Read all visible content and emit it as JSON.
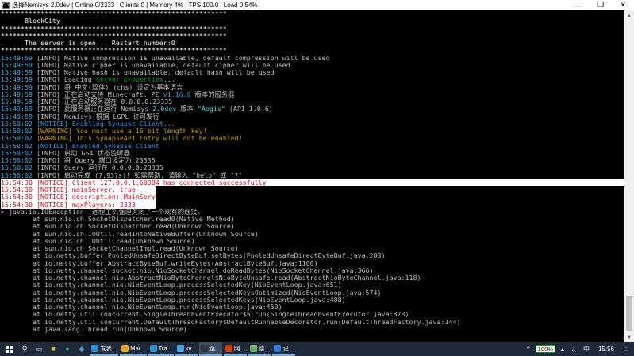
{
  "window": {
    "title": "选择Nemisys 2.0dev | Online 0/2333 | Clients 0 | Memory 4% | TPS 100.0 | Load 0.54%",
    "icon": "console-icon"
  },
  "console": {
    "lines": [
      [
        {
          "t": "*********************************************************",
          "c": "c-w"
        }
      ],
      [
        {
          "t": "      BlockCity",
          "c": "c-w"
        }
      ],
      [
        {
          "t": "*********************************************************",
          "c": "c-w"
        }
      ],
      [
        {
          "t": "*********************************************************",
          "c": "c-w"
        }
      ],
      [
        {
          "t": "      The server is open... Restart number:0",
          "c": "c-w"
        }
      ],
      [
        {
          "t": "*********************************************************",
          "c": "c-w"
        }
      ],
      [
        {
          "t": "15:49:59 ",
          "c": "c-ts"
        },
        {
          "t": "[INFO] Native compression is unavailable, default compression will be used",
          "c": "c-g"
        }
      ],
      [
        {
          "t": "15:49:59 ",
          "c": "c-ts"
        },
        {
          "t": "[INFO] Native cipher is unavailable, default cipher will be used",
          "c": "c-g"
        }
      ],
      [
        {
          "t": "15:49:59 ",
          "c": "c-ts"
        },
        {
          "t": "[INFO] Native hash is unavailable, default hash will be used",
          "c": "c-g"
        }
      ],
      [
        {
          "t": "15:49:59 ",
          "c": "c-ts"
        },
        {
          "t": "[INFO] Loading ",
          "c": "c-g"
        },
        {
          "t": "server properties",
          "c": "c-g2"
        },
        {
          "t": "...",
          "c": "c-g"
        }
      ],
      [
        {
          "t": "15:49:59 ",
          "c": "c-ts"
        },
        {
          "t": "[INFO] 将 中文(简体) (chs) 设定为基本语言",
          "c": "c-g"
        }
      ],
      [
        {
          "t": "15:49:59 ",
          "c": "c-ts"
        },
        {
          "t": "[INFO] 正在启动支持 Minecraft: PE ",
          "c": "c-g"
        },
        {
          "t": "v1.16.0",
          "c": "c-c"
        },
        {
          "t": " 版本的服务器",
          "c": "c-g"
        }
      ],
      [
        {
          "t": "15:49:59 ",
          "c": "c-ts"
        },
        {
          "t": "[INFO] 正在启动服务器在 0.0.0.0:23335",
          "c": "c-g"
        }
      ],
      [
        {
          "t": "15:49:59 ",
          "c": "c-ts"
        },
        {
          "t": "[INFO] 此服务器正在运行 Nemisys ",
          "c": "c-g"
        },
        {
          "t": "2.0dev",
          "c": "c-ct"
        },
        {
          "t": " 版本 ",
          "c": "c-g"
        },
        {
          "t": "\"Aegis\"",
          "c": "c-ct"
        },
        {
          "t": " (API 1.0.6)",
          "c": "c-g"
        }
      ],
      [
        {
          "t": "15:49:59 ",
          "c": "c-ts"
        },
        {
          "t": "[INFO] Nemisys 根据 LGPL 许可发行",
          "c": "c-g"
        }
      ],
      [
        {
          "t": "15:50:02 ",
          "c": "c-ts"
        },
        {
          "t": "[NOTICE] Enabling Synapse Client...",
          "c": "c-c"
        }
      ],
      [
        {
          "t": "15:50:02 ",
          "c": "c-ts"
        },
        {
          "t": "[WARNING] You must use a 16 bit length key!",
          "c": "c-y"
        }
      ],
      [
        {
          "t": "15:50:02 ",
          "c": "c-ts"
        },
        {
          "t": "[WARNING] This SynapseAPI Entry will not be enabled!",
          "c": "c-y"
        }
      ],
      [
        {
          "t": "15:50:02 ",
          "c": "c-ts"
        },
        {
          "t": "[NOTICE] Enabled Synapse Client",
          "c": "c-c"
        }
      ],
      [
        {
          "t": "15:50:02 ",
          "c": "c-ts"
        },
        {
          "t": "[INFO] 启动 GS4 状态监听器",
          "c": "c-g"
        }
      ],
      [
        {
          "t": "15:50:02 ",
          "c": "c-ts"
        },
        {
          "t": "[INFO] 将 Query 端口设定为 23335",
          "c": "c-g"
        }
      ],
      [
        {
          "t": "15:50:02 ",
          "c": "c-ts"
        },
        {
          "t": "[INFO] Query 运行在 0.0.0.0:23335",
          "c": "c-g"
        }
      ],
      [
        {
          "t": "15:50:02 ",
          "c": "c-ts"
        },
        {
          "t": "[INFO] 启动完成 (7.937s)! 如需帮助, 请输入 \"help\" 或 \"?\"",
          "c": "c-g"
        }
      ],
      [
        {
          "t": "15:54:30 [NOTICE] Client 127.0.0.1:60384 has connected successfully",
          "c": "c-r",
          "sel": true
        }
      ],
      [
        {
          "t": "15:54:30 [NOTICE] mainServer: true",
          "c": "c-r",
          "sel": true,
          "selw": 195
        }
      ],
      [
        {
          "t": "15:54:30 [NOTICE] description: MainServer",
          "c": "c-r",
          "sel": true,
          "selw": 195
        }
      ],
      [
        {
          "t": "15:54:30 [NOTICE] maxPlayers: 2333",
          "c": "c-r",
          "sel": true,
          "selw": 195
        }
      ],
      [
        {
          "t": "> java.io.IOException: 远程主机强迫关闭了一个现有的连接。",
          "c": "c-g"
        }
      ],
      [
        {
          "t": "        at sun.nio.ch.SocketDispatcher.read0(Native Method)",
          "c": "c-g"
        }
      ],
      [
        {
          "t": "        at sun.nio.ch.SocketDispatcher.read(Unknown Source)",
          "c": "c-g"
        }
      ],
      [
        {
          "t": "        at sun.nio.ch.IOUtil.readIntoNativeBuffer(Unknown Source)",
          "c": "c-g"
        }
      ],
      [
        {
          "t": "        at sun.nio.ch.IOUtil.read(Unknown Source)",
          "c": "c-g"
        }
      ],
      [
        {
          "t": "        at sun.nio.ch.SocketChannelImpl.read(Unknown Source)",
          "c": "c-g"
        }
      ],
      [
        {
          "t": "        at io.netty.buffer.PooledUnsafeDirectByteBuf.setBytes(PooledUnsafeDirectByteBuf.java:288)",
          "c": "c-g"
        }
      ],
      [
        {
          "t": "        at io.netty.buffer.AbstractByteBuf.writeBytes(AbstractByteBuf.java:1100)",
          "c": "c-g"
        }
      ],
      [
        {
          "t": "        at io.netty.channel.socket.nio.NioSocketChannel.doReadBytes(NioSocketChannel.java:366)",
          "c": "c-g"
        }
      ],
      [
        {
          "t": "        at io.netty.channel.nio.AbstractNioByteChannel$NioByteUnsafe.read(AbstractNioByteChannel.java:118)",
          "c": "c-g"
        }
      ],
      [
        {
          "t": "        at io.netty.channel.nio.NioEventLoop.processSelectedKey(NioEventLoop.java:651)",
          "c": "c-g"
        }
      ],
      [
        {
          "t": "        at io.netty.channel.nio.NioEventLoop.processSelectedKeysOptimized(NioEventLoop.java:574)",
          "c": "c-g"
        }
      ],
      [
        {
          "t": "        at io.netty.channel.nio.NioEventLoop.processSelectedKeys(NioEventLoop.java:488)",
          "c": "c-g"
        }
      ],
      [
        {
          "t": "        at io.netty.channel.nio.NioEventLoop.run(NioEventLoop.java:450)",
          "c": "c-g"
        }
      ],
      [
        {
          "t": "        at io.netty.util.concurrent.SingleThreadEventExecutor$5.run(SingleThreadEventExecutor.java:873)",
          "c": "c-g"
        }
      ],
      [
        {
          "t": "        at io.netty.util.concurrent.DefaultThreadFactory$DefaultRunnableDecorator.run(DefaultThreadFactory.java:144)",
          "c": "c-g"
        }
      ],
      [
        {
          "t": "        at java.lang.Thread.run(Unknown Source)",
          "c": "c-g"
        }
      ]
    ]
  },
  "taskbar": {
    "apps": [
      {
        "label": "发表...",
        "color": "#2b8fd6",
        "name": "taskbar-app-browser"
      },
      {
        "label": "Mai...",
        "color": "#e6a817",
        "name": "taskbar-app-mail"
      },
      {
        "label": "Tra...",
        "color": "#2b8fd6",
        "name": "taskbar-app-translate"
      },
      {
        "label": "kv...",
        "color": "#4aa3df",
        "name": "taskbar-app-kv"
      },
      {
        "label": "选...",
        "color": "#333333",
        "name": "taskbar-app-console",
        "active": true
      },
      {
        "label": "网...",
        "color": "#d83b01",
        "name": "taskbar-app-network"
      },
      {
        "label": "德...",
        "color": "#6bb36b",
        "name": "taskbar-app-other"
      },
      {
        "label": "记...",
        "color": "#2d7bd6",
        "name": "taskbar-app-notes"
      }
    ],
    "battery": "100%",
    "ime": "中",
    "clock": "15:56"
  }
}
